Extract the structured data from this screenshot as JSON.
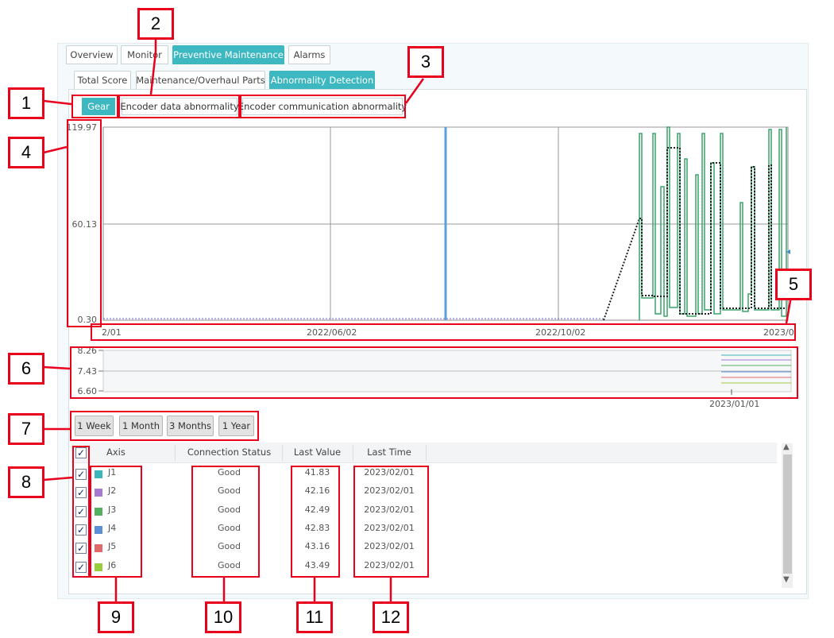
{
  "tabs": [
    {
      "label": "Overview",
      "active": false
    },
    {
      "label": "Monitor",
      "active": false
    },
    {
      "label": "Preventive Maintenance",
      "active": true
    },
    {
      "label": "Alarms",
      "active": false
    }
  ],
  "subtabs": [
    {
      "label": "Total Score",
      "active": false
    },
    {
      "label": "Maintenance/Overhaul Parts",
      "active": false
    },
    {
      "label": "Abnormality Detection",
      "active": true
    }
  ],
  "detection_types": [
    {
      "label": "Gear",
      "active": true
    },
    {
      "label": "Encoder data abnormality",
      "active": false
    },
    {
      "label": "Encoder communication abnormality",
      "active": false
    }
  ],
  "chart_data": [
    {
      "type": "line",
      "yticks": [
        "119.97",
        "60.13",
        "0.30"
      ],
      "ylim": [
        0.3,
        119.97
      ],
      "xticks": [
        "2/01",
        "2022/06/02",
        "2022/10/02",
        "2023/0"
      ],
      "grid": true,
      "cursor_color": "#5aa0e0",
      "series_color": "#3aa36a",
      "trend_color": "#222222"
    },
    {
      "type": "line",
      "yticks": [
        "8.26",
        "7.43",
        "6.60"
      ],
      "ylim": [
        6.6,
        8.26
      ],
      "xticks": [
        "2023/01/01"
      ]
    }
  ],
  "range_buttons": [
    "1 Week",
    "1 Month",
    "3 Months",
    "1 Year"
  ],
  "table": {
    "headers": [
      "Axis",
      "Connection Status",
      "Last Value",
      "Last Time"
    ],
    "rows": [
      {
        "checked": true,
        "axis": "J1",
        "color": "#3cb6bb",
        "status": "Good",
        "value": "41.83",
        "time": "2023/02/01"
      },
      {
        "checked": true,
        "axis": "J2",
        "color": "#a679d2",
        "status": "Good",
        "value": "42.16",
        "time": "2023/02/01"
      },
      {
        "checked": true,
        "axis": "J3",
        "color": "#52b05e",
        "status": "Good",
        "value": "42.49",
        "time": "2023/02/01"
      },
      {
        "checked": true,
        "axis": "J4",
        "color": "#5b8fd6",
        "status": "Good",
        "value": "42.83",
        "time": "2023/02/01"
      },
      {
        "checked": true,
        "axis": "J5",
        "color": "#e06a6a",
        "status": "Good",
        "value": "43.16",
        "time": "2023/02/01"
      },
      {
        "checked": true,
        "axis": "J6",
        "color": "#9acd3c",
        "status": "Good",
        "value": "43.49",
        "time": "2023/02/01"
      }
    ]
  },
  "callouts": [
    "1",
    "2",
    "3",
    "4",
    "5",
    "6",
    "7",
    "8",
    "9",
    "10",
    "11",
    "12"
  ],
  "annotation_color": "#e8001c"
}
